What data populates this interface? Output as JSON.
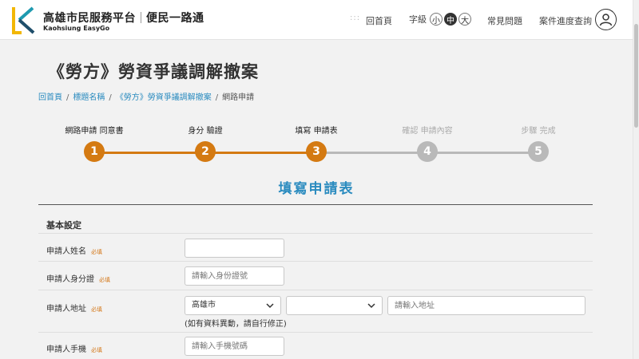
{
  "header": {
    "site_title": "高雄市民服務平台",
    "site_slogan": "便民一路通",
    "site_subtitle": "Kaohsiung EasyGo",
    "nav_home": "回首頁",
    "font_size_label": "字級",
    "font_sizes": [
      "小",
      "中",
      "大"
    ],
    "font_size_selected": "中",
    "nav_faq": "常見問題",
    "nav_progress": "案件進度查詢",
    "brand_colors": {
      "logo_yellow": "#f2b705",
      "logo_teal": "#1e9ab0",
      "logo_dark": "#1f4e6b"
    }
  },
  "page": {
    "title": "《勞方》勞資爭議調解撤案",
    "breadcrumb": [
      "回首頁",
      "標題名稱",
      "《勞方》勞資爭議調解撤案",
      "網路申請"
    ]
  },
  "steps": {
    "items": [
      {
        "number": "1",
        "label": "網路申請 同意書",
        "state": "done"
      },
      {
        "number": "2",
        "label": "身分 驗證",
        "state": "done"
      },
      {
        "number": "3",
        "label": "填寫 申請表",
        "state": "current"
      },
      {
        "number": "4",
        "label": "確認 申請內容",
        "state": "pending"
      },
      {
        "number": "5",
        "label": "步驟 完成",
        "state": "pending"
      }
    ],
    "active_color": "#d47a12",
    "pending_color": "#b9b9b9"
  },
  "form": {
    "heading": "填寫申請表",
    "group_title": "基本設定",
    "required_mark": "必填",
    "name": {
      "label": "申請人姓名",
      "value": "",
      "placeholder": ""
    },
    "id_number": {
      "label": "申請人身分證",
      "value": "",
      "placeholder": "請輸入身份證號"
    },
    "address": {
      "label": "申請人地址",
      "city_selected": "高雄市",
      "district_selected": "",
      "placeholder": "請輸入地址",
      "note": "(如有資料異動，請自行修正)"
    },
    "mobile": {
      "label": "申請人手機",
      "value": "",
      "placeholder": "請輸入手機號碼"
    }
  }
}
